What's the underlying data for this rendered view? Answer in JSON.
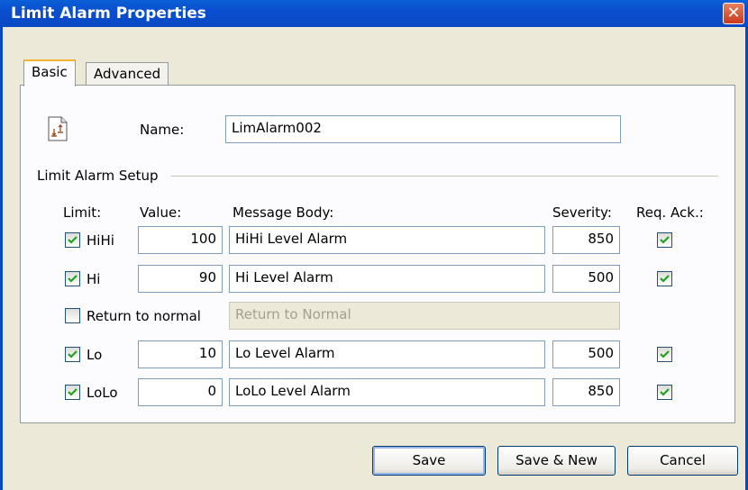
{
  "window": {
    "title": "Limit Alarm Properties",
    "close_glyph": "✕"
  },
  "tabs": [
    {
      "label": "Basic",
      "active": true
    },
    {
      "label": "Advanced",
      "active": false
    }
  ],
  "general": {
    "icon": "alarm-document-icon",
    "name_label": "Name:",
    "name_value": "LimAlarm002"
  },
  "setup": {
    "group_label": "Limit Alarm Setup",
    "headers": {
      "limit": "Limit:",
      "value": "Value:",
      "message": "Message Body:",
      "severity": "Severity:",
      "req_ack": "Req. Ack.:"
    },
    "rows": [
      {
        "limit": "HiHi",
        "enabled": true,
        "value": "100",
        "message": "HiHi Level Alarm",
        "severity": "850",
        "req_ack": true
      },
      {
        "limit": "Hi",
        "enabled": true,
        "value": "90",
        "message": "Hi Level Alarm",
        "severity": "500",
        "req_ack": true
      },
      {
        "limit": "Return to normal",
        "enabled": false,
        "message": "Return to Normal"
      },
      {
        "limit": "Lo",
        "enabled": true,
        "value": "10",
        "message": "Lo Level Alarm",
        "severity": "500",
        "req_ack": true
      },
      {
        "limit": "LoLo",
        "enabled": true,
        "value": "0",
        "message": "LoLo Level Alarm",
        "severity": "850",
        "req_ack": true
      }
    ]
  },
  "buttons": {
    "save": "Save",
    "save_new": "Save & New",
    "cancel": "Cancel"
  }
}
